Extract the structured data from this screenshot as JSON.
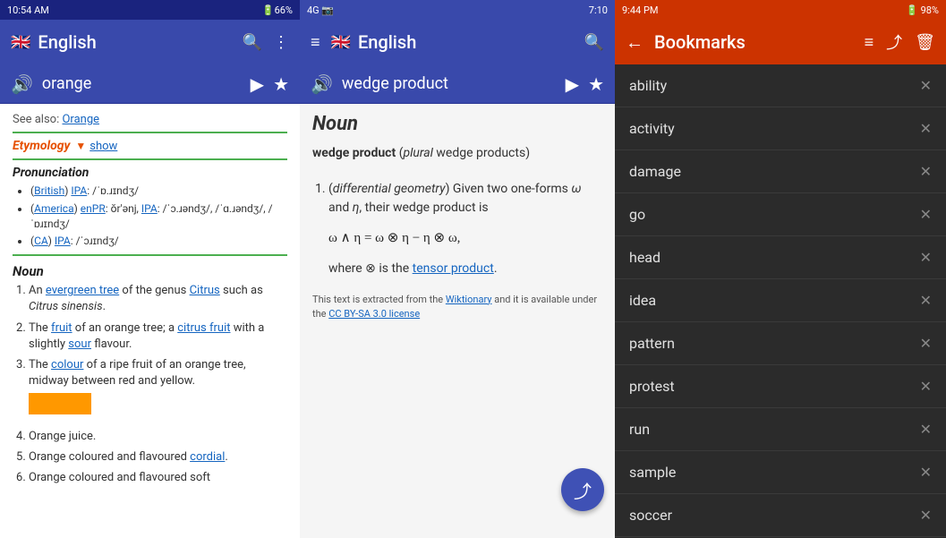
{
  "panel1": {
    "statusBar": {
      "time": "10:54 AM",
      "icons": "🔇 ⚡ 📶 🔋 66%"
    },
    "appBar": {
      "flag": "🇬🇧",
      "title": "English",
      "searchIcon": "🔍",
      "menuIcon": "⋮"
    },
    "wordBar": {
      "word": "orange",
      "speakerIcon": "🔊",
      "playIcon": "▶",
      "starIcon": "★"
    },
    "seeAlso": {
      "label": "See also:",
      "link": "Orange"
    },
    "etymology": {
      "label": "Etymology",
      "arrow": "▼",
      "show": "show"
    },
    "pronunciation": {
      "label": "Pronunciation",
      "items": [
        "(British) IPA: /ˈɒ.ɹɪndʒ/",
        "(America) enPR: ŏr'ənj, IPA: /ˈɔ.ɹəndʒ/, /ˈɑ.ɹəndʒ/, /ˈɒɹɪndʒ/",
        "(CA) IPA: /ˈɔɹɪndʒ/"
      ]
    },
    "noun": {
      "label": "Noun",
      "definitions": [
        "An evergreen tree of the genus Citrus such as Citrus sinensis.",
        "The fruit of an orange tree; a citrus fruit with a slightly sour flavour.",
        "The colour of a ripe fruit of an orange tree, midway between red and yellow.",
        "Orange juice.",
        "Orange coloured and flavoured cordial.",
        "Orange coloured and flavoured soft"
      ]
    }
  },
  "panel2": {
    "statusBar": {
      "time": "7:10",
      "signal": "4G"
    },
    "appBar": {
      "flag": "🇬🇧",
      "title": "English",
      "hamburgerIcon": "≡",
      "searchIcon": "🔍"
    },
    "wordBar": {
      "word": "wedge product",
      "speakerIcon": "🔊",
      "playIcon": "▶",
      "starIcon": "★"
    },
    "content": {
      "nounLabel": "Noun",
      "boldWord": "wedge product",
      "pluralNote": "(plural wedge products)",
      "definition": "(differential geometry) Given two one-forms ω and η, their wedge product is",
      "formula": "ω ∧ η = ω ⊗ η − η ⊗ ω,",
      "whereText": "where ⊗ is the",
      "tensorLink": "tensor product",
      "period": ".",
      "footerText": "This text is extracted from the",
      "wiktionaryLink": "Wiktionary",
      "footerMiddle": "and it is available under the",
      "licenseLink": "CC BY-SA 3.0 license"
    },
    "fab": {
      "shareIcon": "⤴"
    }
  },
  "panel3": {
    "statusBar": {
      "time": "9:44 PM",
      "battery": "98%"
    },
    "appBar": {
      "backIcon": "←",
      "title": "Bookmarks",
      "sortIcon": "≡",
      "shareIcon": "⤴",
      "deleteIcon": "🗑"
    },
    "bookmarks": [
      "ability",
      "activity",
      "damage",
      "go",
      "head",
      "idea",
      "pattern",
      "protest",
      "run",
      "sample",
      "soccer"
    ]
  }
}
